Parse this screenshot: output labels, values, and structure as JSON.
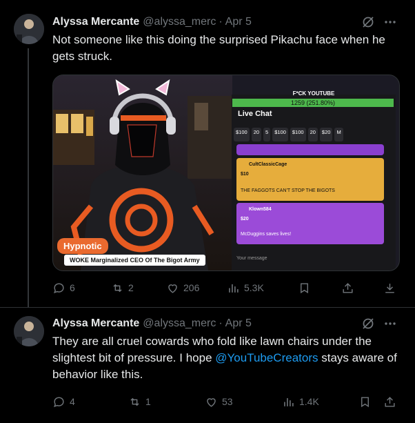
{
  "tweets": [
    {
      "author_name": "Alyssa Mercante",
      "handle": "@alyssa_merc",
      "separator": "·",
      "time": "Apr 5",
      "text": "Not someone like this doing the surprised Pikachu face when he gets struck.",
      "media": {
        "overlay_label": "Hypnotic",
        "caption": "WOKE Marginalized CEO Of The Bigot Army",
        "stream_title": "F*CK YOUTUBE",
        "progress_text": "1259 (251.80%)",
        "progress_fraction": 1.0,
        "chat_header": "Live Chat",
        "emotes": [
          "$100",
          "20",
          "5",
          "$100",
          "$100",
          "20",
          "$20",
          "M"
        ],
        "donation1_user": "CultClassicCage",
        "donation1_amount": "$10",
        "donation1_message": "THE FAGGOTS CAN'T STOP THE BIGOTS",
        "donation2_user": "Klown584",
        "donation2_amount": "$20",
        "donation2_message": "McDuggins saves lives!",
        "input_placeholder": "Your message"
      },
      "actions": {
        "replies": "6",
        "reposts": "2",
        "likes": "206",
        "views": "5.3K"
      }
    },
    {
      "author_name": "Alyssa Mercante",
      "handle": "@alyssa_merc",
      "separator": "·",
      "time": "Apr 5",
      "text_part1": "They are all cruel cowards who fold like lawn chairs under the slightest bit of pressure. I hope ",
      "mention": "@YouTubeCreators",
      "text_part2": " stays aware of behavior like this.",
      "actions": {
        "replies": "4",
        "reposts": "1",
        "likes": "53",
        "views": "1.4K"
      }
    }
  ],
  "colors": {
    "background": "#000000",
    "text": "#e7e9ea",
    "muted": "#71767b",
    "link": "#1d9bf0",
    "border": "#2f3336"
  },
  "icons": [
    "grok-icon",
    "more-icon",
    "reply-icon",
    "repost-icon",
    "like-icon",
    "views-icon",
    "bookmark-icon",
    "share-icon",
    "download-icon"
  ]
}
